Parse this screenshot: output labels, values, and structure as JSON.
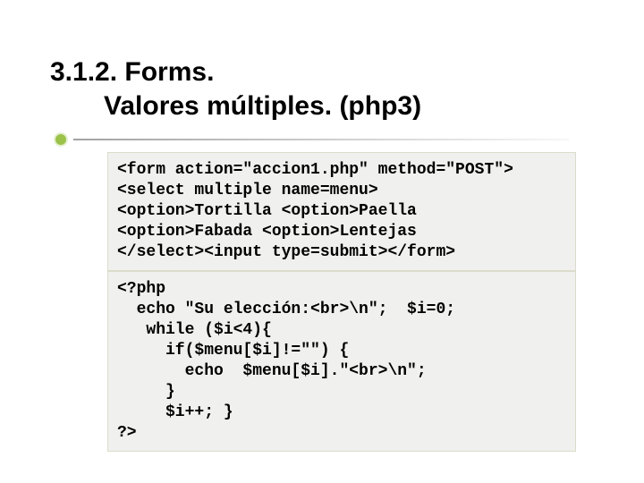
{
  "title_line1": "3.1.2. Forms.",
  "title_line2": "Valores múltiples. (php3)",
  "code1": "<form action=\"accion1.php\" method=\"POST\">\n<select multiple name=menu>\n<option>Tortilla <option>Paella\n<option>Fabada <option>Lentejas\n</select><input type=submit></form>",
  "code2": "<?php\n  echo \"Su elección:<br>\\n\";  $i=0;\n   while ($i<4){\n     if($menu[$i]!=\"\") {\n       echo  $menu[$i].\"<br>\\n\";\n     }\n     $i++; }\n?>"
}
